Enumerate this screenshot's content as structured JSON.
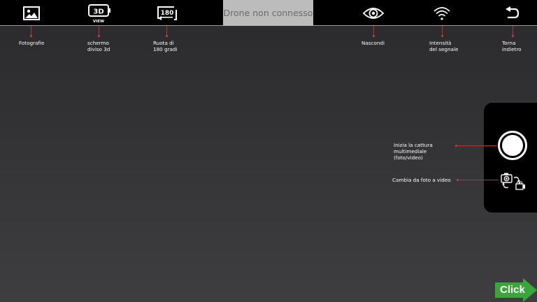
{
  "topbar": {
    "status_text": "Drone non connesso",
    "view_icon_text": "3D",
    "view_icon_subtext": "VIEW",
    "rotate_icon_text": "180"
  },
  "callouts": {
    "photos": "Fotografie",
    "split3d": "schermo\ndiviso 3d",
    "rotate": "Ruota di\n180 gradi",
    "hide": "Nascondi",
    "signal": "Intensità\ndel segnale",
    "back": "Torna\nindietro",
    "capture": "Inizia la cattura\nmultimediale\n(foto/video)",
    "switch": "Cambia da foto a video"
  },
  "click_button": {
    "label": "Click",
    "color": "#3aa63a"
  },
  "accent_color": "#c0302a",
  "icons": [
    "gallery-icon",
    "3d-view-icon",
    "rotate-180-icon",
    "eye-icon",
    "wifi-icon",
    "back-icon",
    "shutter-icon",
    "photo-video-switch-icon",
    "arrow-right-icon"
  ]
}
